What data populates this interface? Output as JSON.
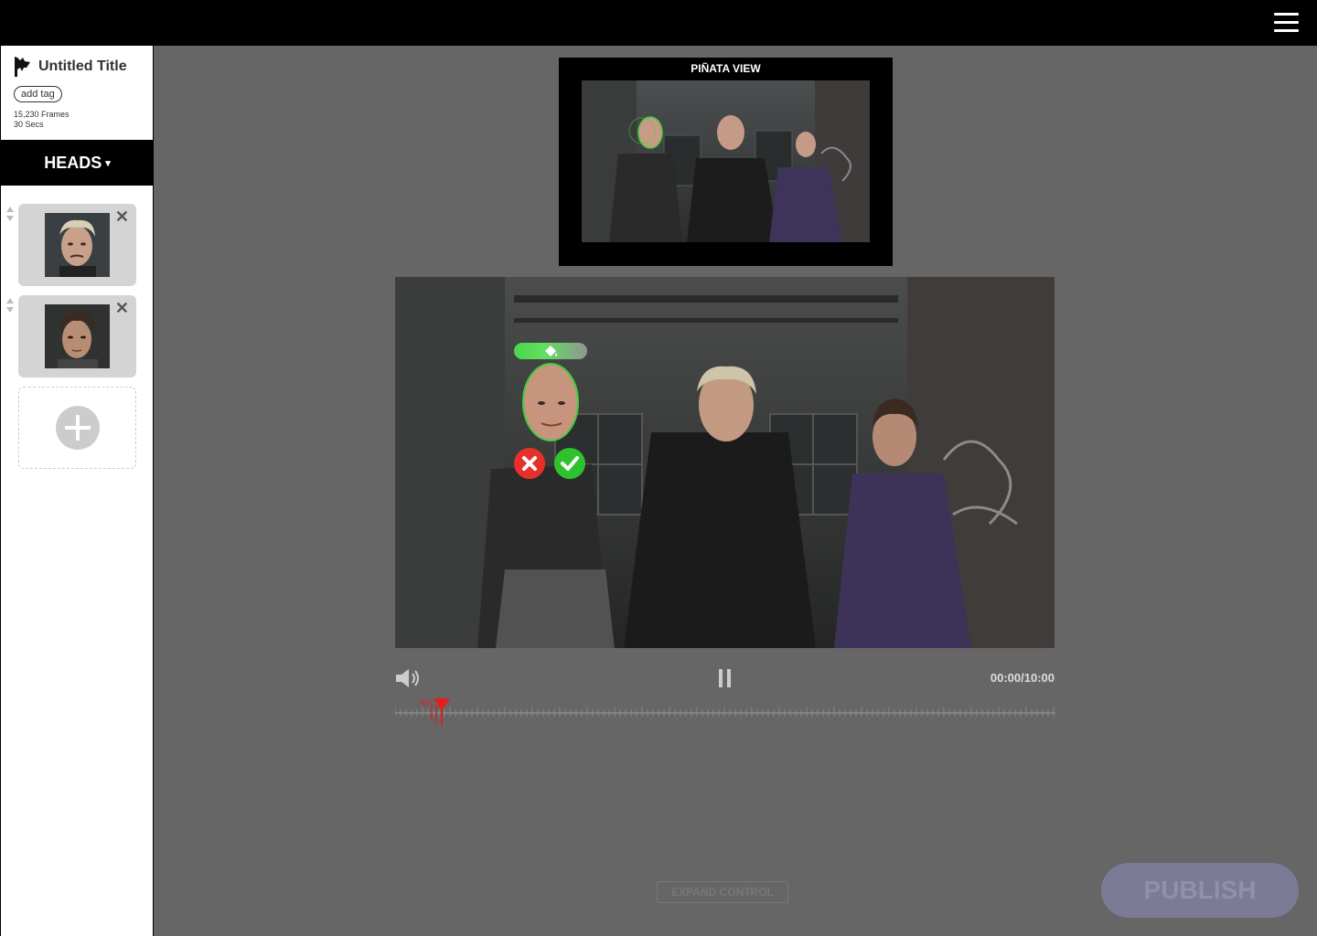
{
  "app": {
    "menu_icon": "hamburger-icon"
  },
  "project": {
    "title": "Untitled Title",
    "add_tag_label": "add tag",
    "frames": "15,230 Frames",
    "duration": "30 Secs",
    "logo_icon": "pinata-logo-icon"
  },
  "sidebar": {
    "section_label": "HEADS",
    "section_caret": "▾",
    "heads": [
      {
        "name": "head-blonde-man",
        "remove_icon": "close-icon"
      },
      {
        "name": "head-dark-hair-man",
        "remove_icon": "close-icon"
      }
    ],
    "add_icon": "plus-icon"
  },
  "preview": {
    "title": "PIÑATA VIEW"
  },
  "player": {
    "time": "00:00/10:00",
    "volume_icon": "volume-icon",
    "pause_icon": "pause-icon",
    "accept_icon": "check-icon",
    "reject_icon": "x-icon",
    "paint_icon": "paint-bucket-icon"
  },
  "footer": {
    "expand_label": "EXPAND CONTROL",
    "publish_label": "PUBLISH"
  },
  "colors": {
    "accent_green": "#2fc22f",
    "reject_red": "#e8302a",
    "marker_red": "#e02020",
    "publish_bg": "#7b7b96"
  }
}
